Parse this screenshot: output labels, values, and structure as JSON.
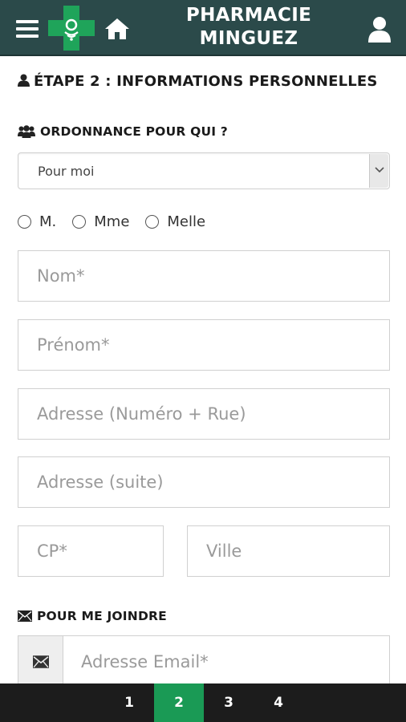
{
  "header": {
    "title_line1": "PHARMACIE",
    "title_line2": "MINGUEZ",
    "menu_icon": "hamburger-menu-icon",
    "logo_icon": "pharmacy-cross-logo",
    "home_icon": "home-icon",
    "user_icon": "user-icon"
  },
  "step": {
    "title": "ÉTAPE 2 : INFORMATIONS PERSONNELLES",
    "icon": "user-icon"
  },
  "prescription": {
    "label": "ORDONNANCE POUR QUI ?",
    "icon": "users-group-icon",
    "selected": "Pour moi"
  },
  "civility": {
    "options": [
      "M.",
      "Mme",
      "Melle"
    ]
  },
  "fields": {
    "nom": "Nom*",
    "prenom": "Prénom*",
    "adresse": "Adresse (Numéro + Rue)",
    "adresse_suite": "Adresse (suite)",
    "cp": "CP*",
    "ville": "Ville"
  },
  "contact": {
    "label": "POUR ME JOINDRE",
    "icon": "envelope-icon",
    "email_placeholder": "Adresse Email*"
  },
  "pager": {
    "pages": [
      "1",
      "2",
      "3",
      "4"
    ],
    "active": "2"
  },
  "colors": {
    "header_bg": "#2b4a4a",
    "accent_green": "#1a9a55",
    "logo_green": "#1fa45a",
    "pager_bg": "#1c1c1c"
  }
}
